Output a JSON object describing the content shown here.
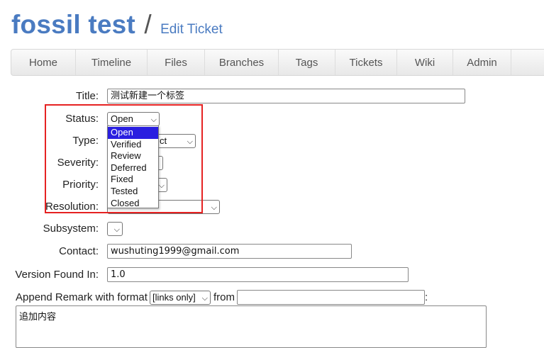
{
  "header": {
    "project_title": "fossil test",
    "separator": "/",
    "page_title": "Edit Ticket"
  },
  "nav": {
    "items": [
      "Home",
      "Timeline",
      "Files",
      "Branches",
      "Tags",
      "Tickets",
      "Wiki",
      "Admin"
    ]
  },
  "form": {
    "title": {
      "label": "Title:",
      "value": "测试新建一个标签"
    },
    "status": {
      "label": "Status:",
      "selected": "Open",
      "options": [
        "Open",
        "Verified",
        "Review",
        "Deferred",
        "Fixed",
        "Tested",
        "Closed"
      ],
      "highlighted_option": "Open"
    },
    "type": {
      "label": "Type:",
      "visible_value": "ct"
    },
    "severity": {
      "label": "Severity:"
    },
    "priority": {
      "label": "Priority:"
    },
    "resolution": {
      "label": "Resolution:"
    },
    "subsystem": {
      "label": "Subsystem:"
    },
    "contact": {
      "label": "Contact:",
      "value": "wushuting1999@gmail.com"
    },
    "version_found": {
      "label": "Version Found In:",
      "value": "1.0"
    },
    "remark": {
      "label_prefix": "Append Remark with format",
      "format_selected": "[links only]",
      "from_label": "from",
      "from_value": "",
      "trailing": ":",
      "text": "追加内容"
    }
  },
  "colors": {
    "link_blue": "#4a7bc1",
    "highlight_red": "#e52222",
    "dropdown_selected": "#2a1fe0"
  }
}
